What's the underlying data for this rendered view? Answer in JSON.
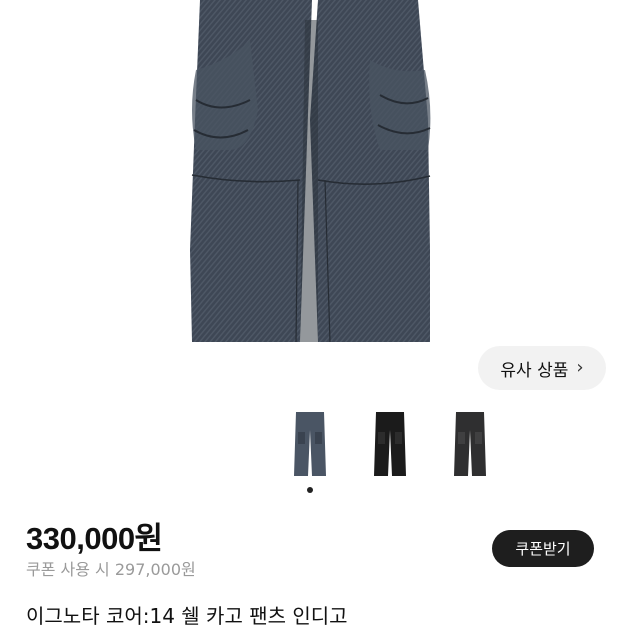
{
  "similar_button": {
    "label": "유사 상품",
    "icon": "chevron-right-icon"
  },
  "gallery": {
    "thumbnails": [
      {
        "icon": "pants-indigo-thumb",
        "color": "#4a5564"
      },
      {
        "icon": "pants-black-thumb",
        "color": "#1b1b1b"
      },
      {
        "icon": "pants-charcoal-thumb",
        "color": "#2f2f30"
      }
    ],
    "active_index": 0
  },
  "product": {
    "price": "330,000원",
    "coupon_price": "쿠폰 사용 시 297,000원",
    "coupon_button": "쿠폰받기",
    "title": "이그노타 코어:14 쉘 카고 팬츠 인디고"
  },
  "colors": {
    "denim": "#3c4552",
    "denim_dark": "#2c333d",
    "pill_bg": "#f2f2f2",
    "button_dark": "#1e1e1e",
    "muted_text": "#9a9a9a"
  }
}
